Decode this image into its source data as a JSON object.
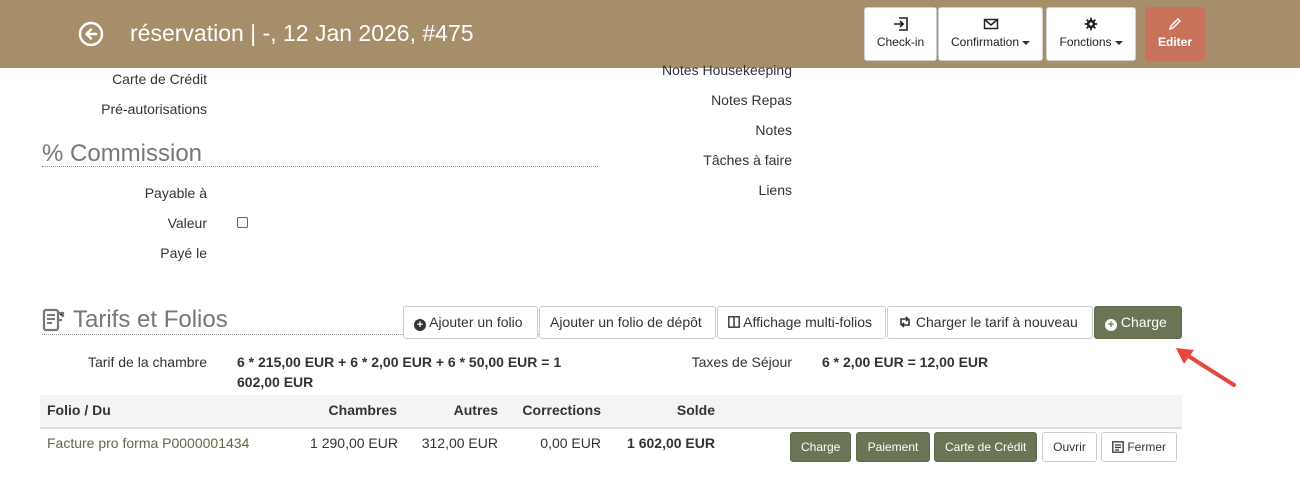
{
  "header": {
    "title": "réservation | -, 12 Jan 2026, #475",
    "checkin_label": "Check-in",
    "confirmation_label": "Confirmation",
    "fonctions_label": "Fonctions",
    "edit_label": "Editer",
    "background_color": "#a68e6a",
    "edit_color": "#c8715b"
  },
  "left_fields": {
    "credit_card": "Carte de Crédit",
    "preauth": "Pré-autorisations"
  },
  "commission": {
    "heading": "% Commission",
    "payable": "Payable à",
    "valeur": "Valeur",
    "paye_le": "Payé le"
  },
  "right_fields": {
    "housekeeping": "Notes Housekeeping",
    "repas": "Notes Repas",
    "notes": "Notes",
    "taches": "Tâches à faire",
    "liens": "Liens"
  },
  "tarifs": {
    "heading": "Tarifs et Folios",
    "buttons": {
      "add_folio": "Ajouter un folio",
      "add_deposit": "Ajouter un folio de dépôt",
      "multi": "Affichage multi-folios",
      "recharge": "Charger le tarif à nouveau",
      "charge": "Charge"
    },
    "room_rate_label": "Tarif de la chambre",
    "room_rate_line1": "6 * 215,00 EUR + 6 * 2,00 EUR + 6 * 50,00 EUR = 1",
    "room_rate_line2": "602,00 EUR",
    "tax_label": "Taxes de Séjour",
    "tax_value": "6 * 2,00 EUR = 12,00 EUR"
  },
  "folio_table": {
    "headers": [
      "Folio / Du",
      "Chambres",
      "Autres",
      "Corrections",
      "Solde"
    ],
    "rows": [
      {
        "folio": "Facture pro forma P0000001434",
        "chambres": "1 290,00 EUR",
        "autres": "312,00 EUR",
        "corrections": "0,00 EUR",
        "solde": "1 602,00 EUR",
        "actions": [
          "Charge",
          "Paiement",
          "Carte de Crédit",
          "Ouvrir",
          "Fermer"
        ]
      }
    ]
  },
  "accent_green": "#6b7556"
}
